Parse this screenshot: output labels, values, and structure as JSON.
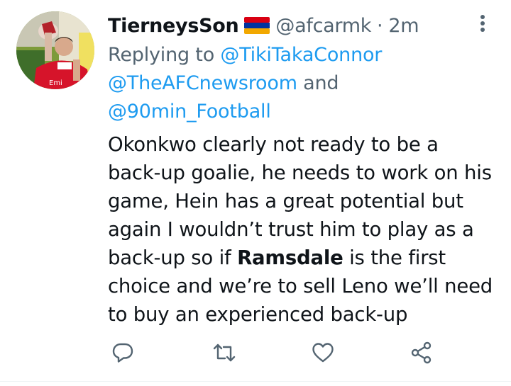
{
  "tweet": {
    "author": {
      "display_name": "TierneysSon",
      "flag_icon": "armenia-flag-icon",
      "handle": "@afcarmk",
      "separator": "·",
      "time": "2m"
    },
    "replying": {
      "prefix": "Replying to ",
      "mention_1": "@TikiTakaConnor",
      "mention_2": "@TheAFCnewsroom",
      "conjunction": " and",
      "mention_3": "@90min_Football"
    },
    "body": {
      "line_1": "Okonkwo clearly not ready to be a",
      "line_2": "back-up goalie, he needs to work on his",
      "line_3": "game, Hein has a great potential but",
      "line_4": "again I wouldn’t trust him to play as a",
      "line_5_pre": "back-up so if ",
      "line_5_bold": "Ramsdale",
      "line_5_post": " is the first",
      "line_6": "choice and we’re to sell Leno we’ll need",
      "line_7": "to buy an experienced back-up"
    },
    "actions": [
      {
        "name": "reply",
        "icon": "reply-icon"
      },
      {
        "name": "retweet",
        "icon": "retweet-icon"
      },
      {
        "name": "like",
        "icon": "heart-icon"
      },
      {
        "name": "share",
        "icon": "share-icon"
      }
    ]
  },
  "colors": {
    "text": "#0f1419",
    "secondary": "#536471",
    "link": "#1d9bf0",
    "divider": "#eff3f4"
  }
}
